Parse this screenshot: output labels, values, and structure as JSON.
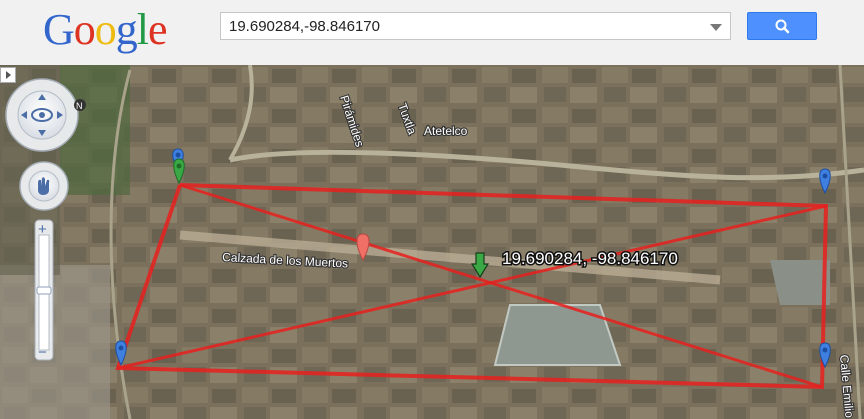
{
  "header": {
    "logo_letters": [
      {
        "char": "G",
        "color": "#3366cc"
      },
      {
        "char": "o",
        "color": "#dd3322"
      },
      {
        "char": "o",
        "color": "#eebb11"
      },
      {
        "char": "g",
        "color": "#3366cc"
      },
      {
        "char": "l",
        "color": "#229944"
      },
      {
        "char": "e",
        "color": "#dd3322"
      }
    ],
    "search_value": "19.690284,-98.846170",
    "search_button_color": "#4d90fe"
  },
  "map": {
    "coord_label": "19.690284, -98.846170",
    "road_labels": [
      "Pirámides",
      "Tuxtla",
      "Atetelco",
      "Calzada de los Muertos",
      "Calle Emilio"
    ],
    "compass_letter": "N",
    "zoom_in_label": "+",
    "zoom_out_label": "−",
    "polygon_color": "#e8201e",
    "marker_colors": {
      "blue": "#3f7fe0",
      "green": "#3aa845",
      "red": "#f07068"
    }
  }
}
